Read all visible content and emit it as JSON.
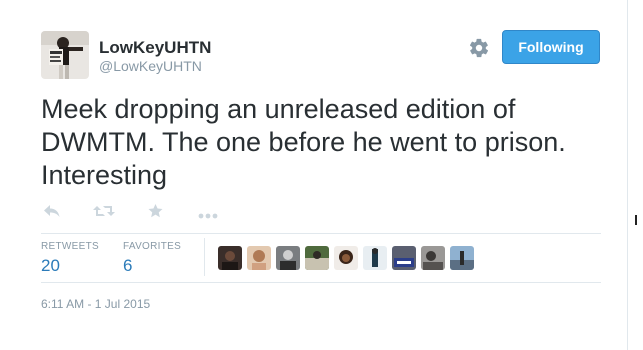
{
  "user": {
    "fullname": "LowKeyUHTN",
    "screenname": "@LowKeyUHTN",
    "avatar_icon": "profile-photo"
  },
  "follow_button": {
    "label": "Following",
    "color": "#3ba3e7"
  },
  "settings_icon": "gear-icon",
  "tweet": {
    "text": "Meek dropping an unreleased edition of DWMTM. The one before he went to prison. Interesting"
  },
  "actions": [
    {
      "name": "reply-icon"
    },
    {
      "name": "retweet-icon"
    },
    {
      "name": "favorite-icon"
    },
    {
      "name": "more-icon"
    }
  ],
  "stats": {
    "retweets_label": "RETWEETS",
    "retweets_value": "20",
    "favorites_label": "FAVORITES",
    "favorites_value": "6"
  },
  "favoriters": [
    {
      "name": "favoriter-avatar-1"
    },
    {
      "name": "favoriter-avatar-2"
    },
    {
      "name": "favoriter-avatar-3"
    },
    {
      "name": "favoriter-avatar-4"
    },
    {
      "name": "favoriter-avatar-5"
    },
    {
      "name": "favoriter-avatar-6"
    },
    {
      "name": "favoriter-avatar-7"
    },
    {
      "name": "favoriter-avatar-8"
    },
    {
      "name": "favoriter-avatar-9"
    }
  ],
  "timestamp": "6:11 AM - 1 Jul 2015",
  "colors": {
    "accent": "#2b7bb9",
    "muted": "#8899a6",
    "text": "#292f33",
    "action_icon": "#ccd6dd"
  }
}
